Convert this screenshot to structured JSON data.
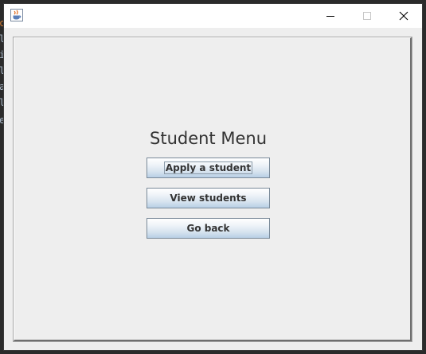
{
  "window": {
    "title": "",
    "controls": {
      "minimize": "minimize",
      "maximize": "maximize",
      "close": "close"
    }
  },
  "menu": {
    "title": "Student Menu",
    "buttons": {
      "apply_label": "Apply a student",
      "view_label": "View students",
      "back_label": "Go back"
    }
  },
  "background": {
    "editor_glyphs": [
      "c",
      "l",
      "i",
      "l",
      "",
      "a",
      "l",
      "e"
    ]
  },
  "colors": {
    "content_bg": "#eeeeee",
    "button_gradient_top": "#ffffff",
    "button_gradient_bottom": "#b8cfe5",
    "button_border": "#7a8a99",
    "text": "#333333",
    "editor_bg": "#2b2b2b",
    "editor_orange_glyph": "#cc7832"
  },
  "icons": {
    "app": "java-coffee-cup-icon",
    "minimize": "minimize-icon",
    "maximize": "maximize-icon",
    "close": "close-icon"
  }
}
